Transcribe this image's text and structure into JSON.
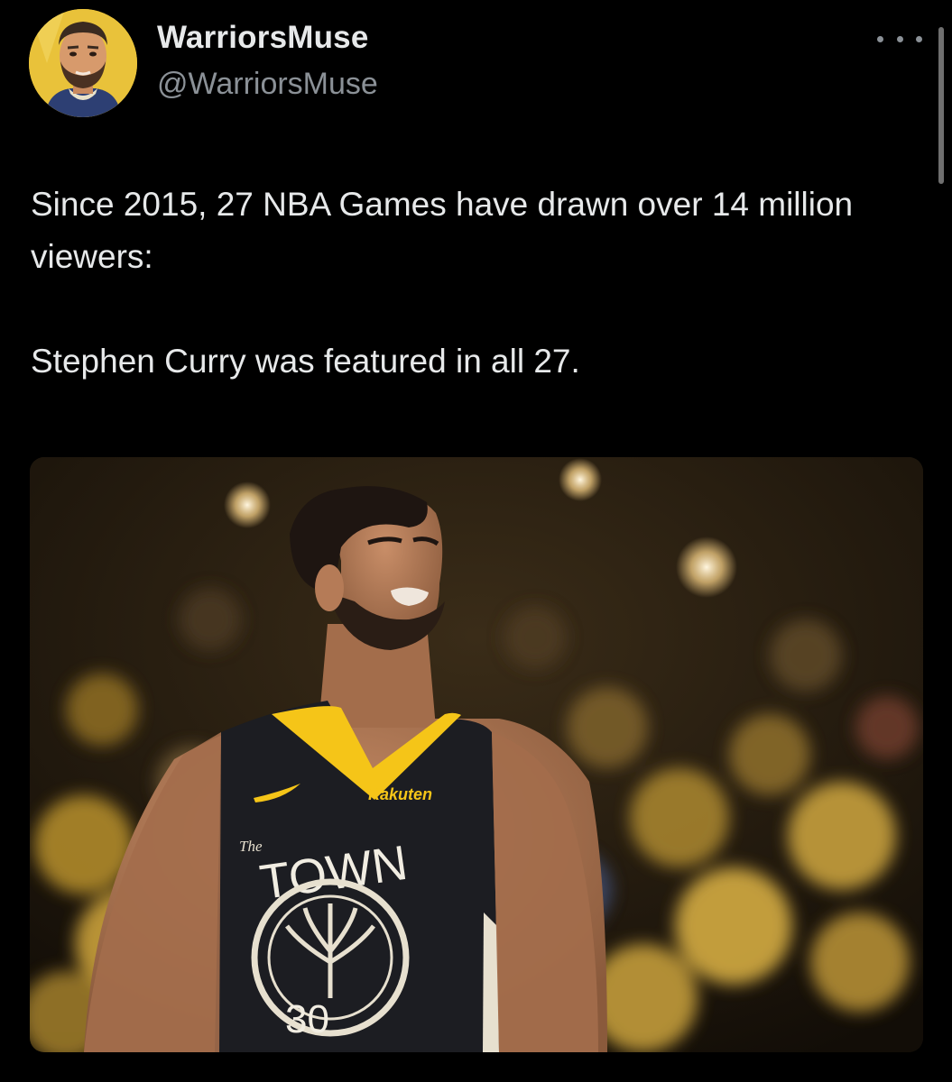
{
  "tweet": {
    "author": {
      "display_name": "WarriorsMuse",
      "handle": "@WarriorsMuse",
      "avatar_icon": "cartoon-portrait-avatar"
    },
    "more_icon": "more-horizontal-icon",
    "text_lines": [
      "Since 2015, 27 NBA Games have drawn over 14 million viewers:",
      "Stephen Curry was featured in all 27."
    ],
    "media": {
      "jersey_sponsor": "Rakuten",
      "jersey_script": "The",
      "jersey_wordmark": "TOWN",
      "jersey_number": "30"
    }
  },
  "colors": {
    "background": "#000000",
    "text_primary": "#e7e9ea",
    "text_secondary": "#8b9197",
    "warriors_gold": "#f5c518",
    "jersey_black": "#1c1d22"
  }
}
